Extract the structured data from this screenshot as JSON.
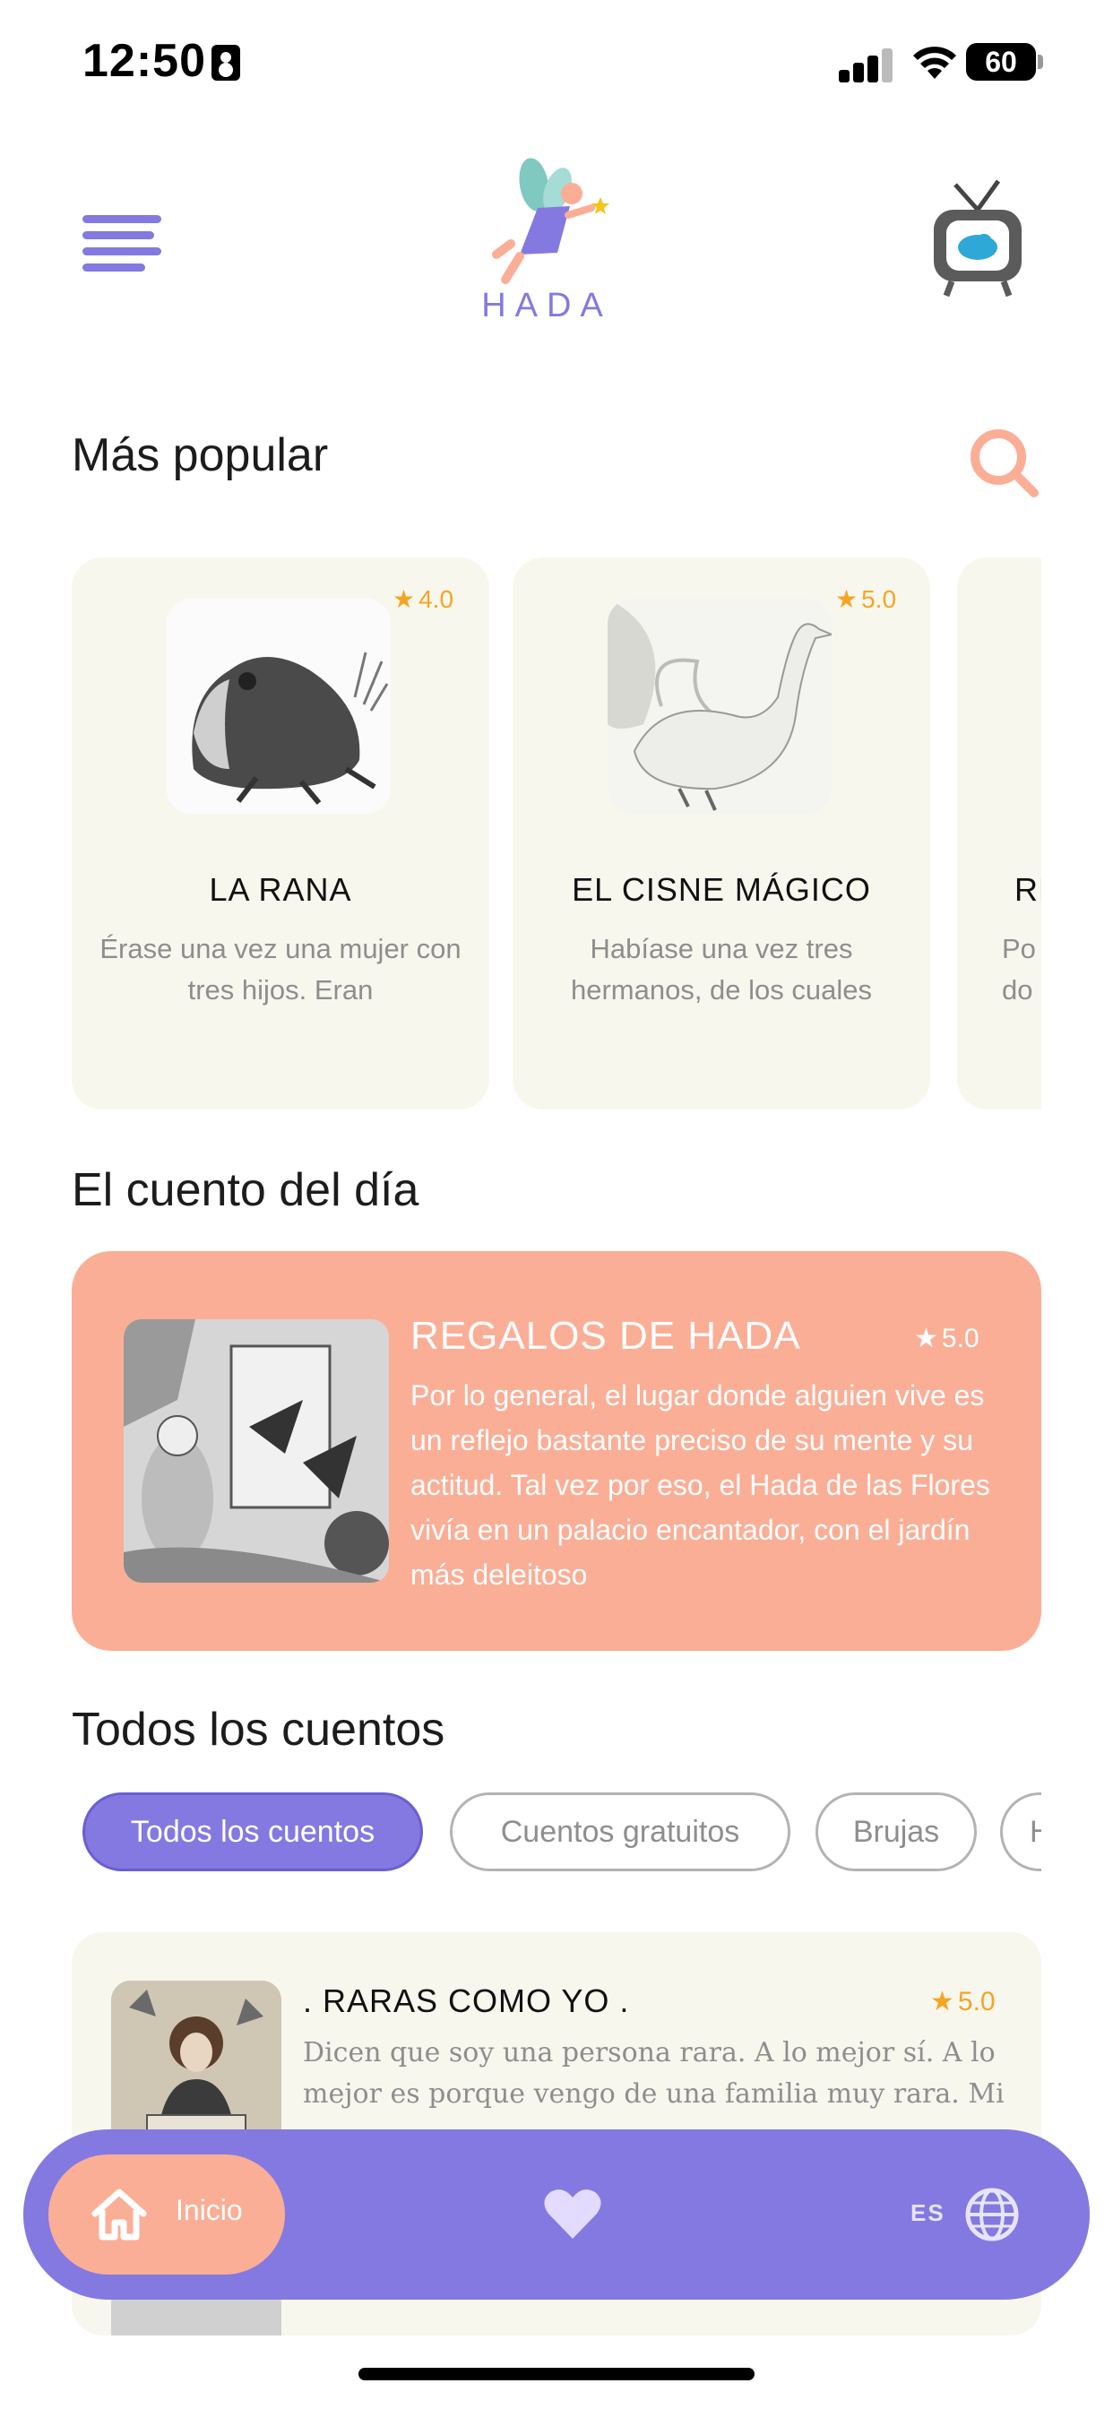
{
  "status_bar": {
    "time": "12:50",
    "battery": "60"
  },
  "header": {
    "logo_text": "HADA",
    "icons": [
      "menu-icon",
      "fairy-logo",
      "tv-icon"
    ]
  },
  "popular": {
    "title": "Más popular",
    "cards": [
      {
        "title": "LA RANA",
        "rating": "4.0",
        "description": "Érase una vez una mujer con tres hijos. Eran"
      },
      {
        "title": "EL CISNE MÁGICO",
        "rating": "5.0",
        "description": "Habíase una vez tres hermanos, de los cuales"
      },
      {
        "title": "RE",
        "rating": "",
        "description": "Po do"
      }
    ]
  },
  "story_of_day": {
    "title": "El cuento del día",
    "card_title": "REGALOS DE HADA",
    "rating": "5.0",
    "description": "Por lo general, el lugar donde alguien vive es un reflejo bastante preciso de su mente y su actitud. Tal vez por eso, el Hada de las Flores vivía en un palacio encantador, con el jardín más deleitoso"
  },
  "all_stories": {
    "title": "Todos los cuentos",
    "chips": [
      "Todos los cuentos",
      "Cuentos gratuitos",
      "Brujas",
      "H"
    ],
    "active_chip": "Todos los cuentos",
    "items": [
      {
        "title": ". RARAS COMO YO .",
        "rating": "5.0",
        "description": "Dicen que soy una persona rara. A lo mejor sí. A lo mejor es porque vengo de una familia muy rara. Mi"
      }
    ]
  },
  "bottom_nav": {
    "home_label": "Inicio",
    "lang_label": "ES"
  },
  "colors": {
    "accent_purple": "#8479e1",
    "peach": "#fbae96",
    "card_bg": "#f8f7ee",
    "star": "#f5a524"
  }
}
